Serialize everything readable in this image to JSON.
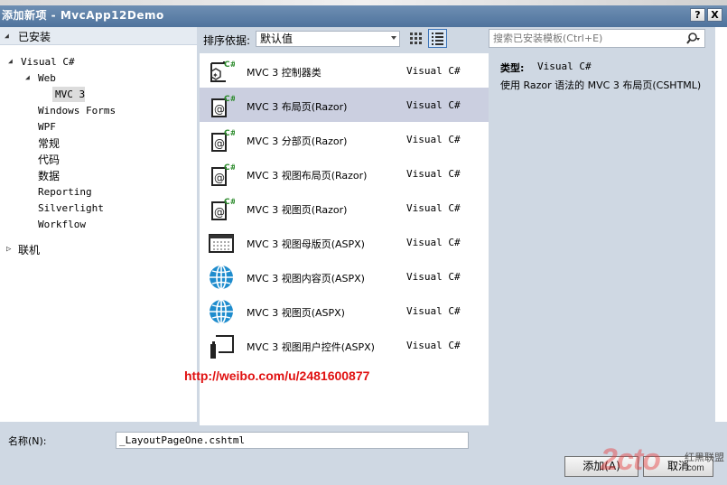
{
  "window": {
    "title": "添加新项 - MvcApp12Demo",
    "help_label": "?",
    "close_label": "X"
  },
  "tree": {
    "installed": "已安装",
    "visual_csharp": "Visual C#",
    "web": "Web",
    "mvc3": "MVC 3",
    "items": [
      "Windows Forms",
      "WPF",
      "常规",
      "代码",
      "数据",
      "Reporting",
      "Silverlight",
      "Workflow"
    ],
    "online": "联机"
  },
  "toolbar": {
    "sort_label": "排序依据:",
    "sort_value": "默认值"
  },
  "search": {
    "placeholder": "搜索已安装模板(Ctrl+E)"
  },
  "templates": [
    {
      "name": "MVC 3 控制器类",
      "lang": "Visual C#",
      "icon": "csharp-class-icon"
    },
    {
      "name": "MVC 3 布局页(Razor)",
      "lang": "Visual C#",
      "icon": "razor-page-icon",
      "selected": true
    },
    {
      "name": "MVC 3 分部页(Razor)",
      "lang": "Visual C#",
      "icon": "razor-page-icon"
    },
    {
      "name": "MVC 3 视图布局页(Razor)",
      "lang": "Visual C#",
      "icon": "razor-page-icon"
    },
    {
      "name": "MVC 3 视图页(Razor)",
      "lang": "Visual C#",
      "icon": "razor-page-icon"
    },
    {
      "name": "MVC 3 视图母版页(ASPX)",
      "lang": "Visual C#",
      "icon": "master-page-icon"
    },
    {
      "name": "MVC 3 视图内容页(ASPX)",
      "lang": "Visual C#",
      "icon": "globe-icon"
    },
    {
      "name": "MVC 3 视图页(ASPX)",
      "lang": "Visual C#",
      "icon": "globe-icon"
    },
    {
      "name": "MVC 3 视图用户控件(ASPX)",
      "lang": "Visual C#",
      "icon": "user-control-icon"
    }
  ],
  "details": {
    "type_label": "类型:",
    "type_value": "Visual C#",
    "description": "使用 Razor 语法的 MVC 3 布局页(CSHTML)"
  },
  "watermark": "http://weibo.com/u/2481600877",
  "bottom": {
    "name_label": "名称(N):",
    "name_value": "_LayoutPageOne.cshtml",
    "add_label": "添加(A)",
    "cancel_label": "取消"
  },
  "brand": {
    "logo": "2cto",
    "name": "红黑联盟",
    "url": ".com"
  },
  "colors": {
    "title_bar": "#4f739d",
    "selection": "#cbcfe0",
    "watermark": "#e01010",
    "csharp_green": "#2a8a2a",
    "globe_blue": "#1e8ccd"
  }
}
